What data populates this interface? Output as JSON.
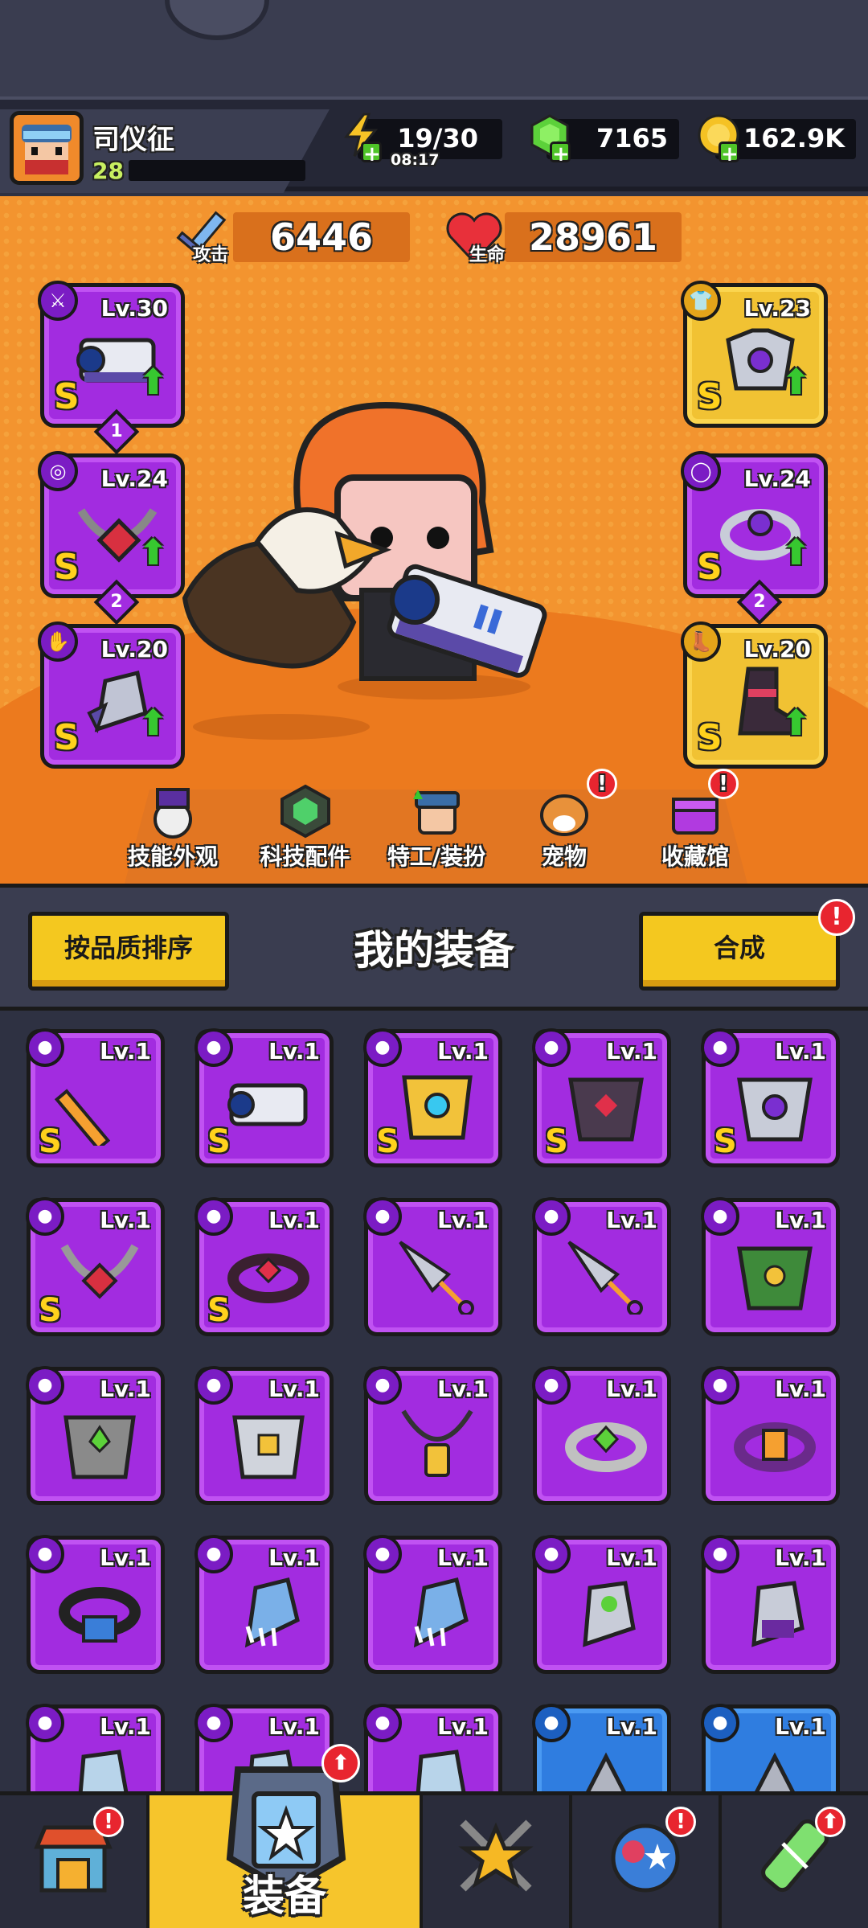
{
  "player": {
    "name": "司仪征",
    "level": "28"
  },
  "resources": {
    "energy": "19/30",
    "energy_timer": "08:17",
    "gems": "7165",
    "gold": "162.9K"
  },
  "stats": {
    "attack_label": "攻击",
    "attack": "6446",
    "hp_label": "生命",
    "hp": "28961"
  },
  "equipped": [
    {
      "slot": "weapon",
      "level": "Lv.30",
      "grade": "S",
      "stars": "1",
      "frame": "purple"
    },
    {
      "slot": "necklace",
      "level": "Lv.24",
      "grade": "S",
      "stars": "2",
      "frame": "purple"
    },
    {
      "slot": "gloves",
      "level": "Lv.20",
      "grade": "S",
      "stars": "",
      "frame": "purple"
    },
    {
      "slot": "armor",
      "level": "Lv.23",
      "grade": "S",
      "stars": "",
      "frame": "yellow"
    },
    {
      "slot": "ring",
      "level": "Lv.24",
      "grade": "S",
      "stars": "2",
      "frame": "yellow"
    },
    {
      "slot": "boots",
      "level": "Lv.20",
      "grade": "S",
      "stars": "",
      "frame": "yellow"
    }
  ],
  "arena_nav": [
    {
      "label": "技能外观",
      "alert": false
    },
    {
      "label": "科技配件",
      "alert": false
    },
    {
      "label": "特工/装扮",
      "alert": false
    },
    {
      "label": "宠物",
      "alert": true
    },
    {
      "label": "收藏馆",
      "alert": true
    }
  ],
  "bag": {
    "sort_label": "按品质排序",
    "title": "我的装备",
    "merge_label": "合成",
    "merge_alert": "!",
    "items": [
      {
        "level": "Lv.1",
        "grade": "S",
        "color": "purple",
        "icon": "sword-icon"
      },
      {
        "level": "Lv.1",
        "grade": "S",
        "color": "purple",
        "icon": "blaster-icon"
      },
      {
        "level": "Lv.1",
        "grade": "S",
        "color": "purple",
        "icon": "mech-armor-icon"
      },
      {
        "level": "Lv.1",
        "grade": "S",
        "color": "purple",
        "icon": "dark-armor-icon"
      },
      {
        "level": "Lv.1",
        "grade": "S",
        "color": "purple",
        "icon": "silver-armor-icon"
      },
      {
        "level": "Lv.1",
        "grade": "S",
        "color": "purple",
        "icon": "chain-necklace-icon"
      },
      {
        "level": "Lv.1",
        "grade": "S",
        "color": "purple",
        "icon": "ruby-ring-icon"
      },
      {
        "level": "Lv.1",
        "grade": "",
        "color": "purple",
        "icon": "kunai-icon"
      },
      {
        "level": "Lv.1",
        "grade": "",
        "color": "purple",
        "icon": "kunai-icon"
      },
      {
        "level": "Lv.1",
        "grade": "",
        "color": "purple",
        "icon": "green-armor-icon"
      },
      {
        "level": "Lv.1",
        "grade": "",
        "color": "purple",
        "icon": "stone-armor-icon"
      },
      {
        "level": "Lv.1",
        "grade": "",
        "color": "purple",
        "icon": "plate-armor-icon"
      },
      {
        "level": "Lv.1",
        "grade": "",
        "color": "purple",
        "icon": "lantern-necklace-icon"
      },
      {
        "level": "Lv.1",
        "grade": "",
        "color": "purple",
        "icon": "emerald-ring-icon"
      },
      {
        "level": "Lv.1",
        "grade": "",
        "color": "purple",
        "icon": "amber-ring-icon"
      },
      {
        "level": "Lv.1",
        "grade": "",
        "color": "purple",
        "icon": "star-ring-icon"
      },
      {
        "level": "Lv.1",
        "grade": "",
        "color": "purple",
        "icon": "claw-glove-icon"
      },
      {
        "level": "Lv.1",
        "grade": "",
        "color": "purple",
        "icon": "claw-glove-icon"
      },
      {
        "level": "Lv.1",
        "grade": "",
        "color": "purple",
        "icon": "green-gauntlet-icon"
      },
      {
        "level": "Lv.1",
        "grade": "",
        "color": "purple",
        "icon": "purple-gauntlet-icon"
      },
      {
        "level": "Lv.1",
        "grade": "",
        "color": "purple",
        "icon": "ice-gauntlet-icon"
      },
      {
        "level": "Lv.1",
        "grade": "",
        "color": "purple",
        "icon": "ice-gauntlet-icon"
      },
      {
        "level": "Lv.1",
        "grade": "",
        "color": "purple",
        "icon": "ice-gauntlet-icon"
      },
      {
        "level": "Lv.1",
        "grade": "",
        "color": "blue",
        "icon": "spear-icon"
      },
      {
        "level": "Lv.1",
        "grade": "",
        "color": "blue",
        "icon": "spear-icon"
      }
    ]
  },
  "tabs": [
    {
      "label": "",
      "icon": "shop-icon",
      "alert": true
    },
    {
      "label": "装备",
      "icon": "equipment-icon",
      "alert": true
    },
    {
      "label": "",
      "icon": "star-swords-icon",
      "alert": false
    },
    {
      "label": "",
      "icon": "planet-icon",
      "alert": true
    },
    {
      "label": "",
      "icon": "dna-capsule-icon",
      "alert": true
    }
  ],
  "colors": {
    "purple": "#a22ce0",
    "yellow": "#f1c233",
    "blue": "#2f7de0",
    "orange": "#f3942f",
    "green_up": "#37c830"
  }
}
